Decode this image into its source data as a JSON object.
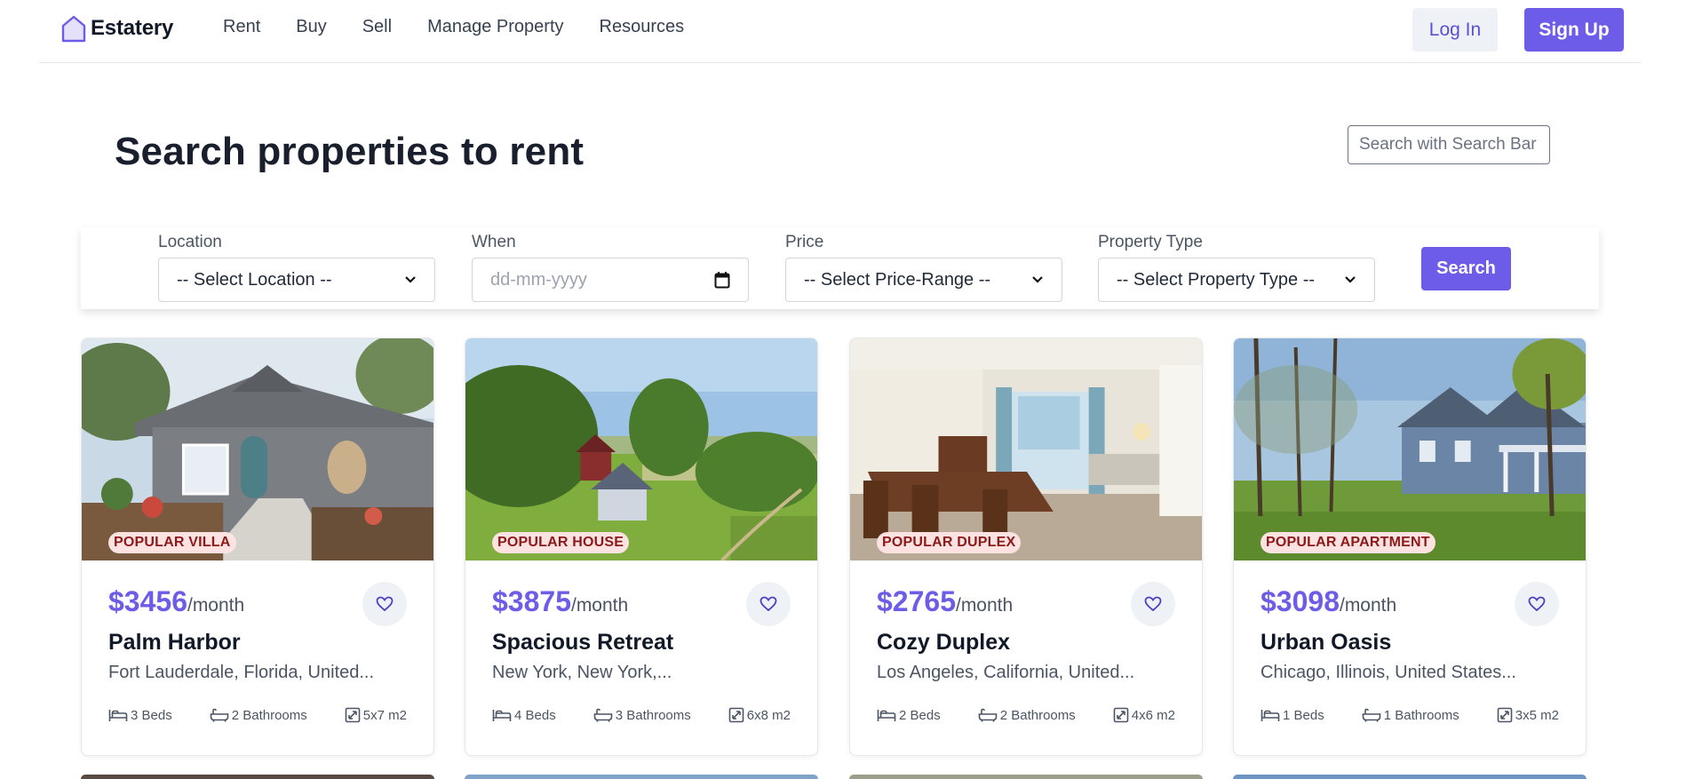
{
  "brand": {
    "name": "Estatery",
    "accent": "#6c5ce7"
  },
  "nav": {
    "links": [
      "Rent",
      "Buy",
      "Sell",
      "Manage Property",
      "Resources"
    ],
    "login_label": "Log In",
    "signup_label": "Sign Up"
  },
  "header": {
    "title": "Search properties to rent",
    "search_placeholder": "Search with Search Bar"
  },
  "filters": {
    "location": {
      "label": "Location",
      "value": "-- Select Location --"
    },
    "when": {
      "label": "When",
      "value": "dd-mm-yyyy"
    },
    "price": {
      "label": "Price",
      "value": "-- Select Price-Range --"
    },
    "type": {
      "label": "Property Type",
      "value": "-- Select Property Type --"
    },
    "search_label": "Search"
  },
  "listings": [
    {
      "badge": "POPULAR VILLA",
      "price": "$3456",
      "unit": "/month",
      "name": "Palm Harbor",
      "location": "Fort Lauderdale, Florida, United...",
      "beds": "3 Beds",
      "baths": "2 Bathrooms",
      "area": "5x7 m2"
    },
    {
      "badge": "POPULAR HOUSE",
      "price": "$3875",
      "unit": "/month",
      "name": "Spacious Retreat",
      "location": "New York, New York,...",
      "beds": "4 Beds",
      "baths": "3 Bathrooms",
      "area": "6x8 m2"
    },
    {
      "badge": "POPULAR DUPLEX",
      "price": "$2765",
      "unit": "/month",
      "name": "Cozy Duplex",
      "location": "Los Angeles, California, United...",
      "beds": "2 Beds",
      "baths": "2 Bathrooms",
      "area": "4x6 m2"
    },
    {
      "badge": "POPULAR APARTMENT",
      "price": "$3098",
      "unit": "/month",
      "name": "Urban Oasis",
      "location": "Chicago, Illinois, United States...",
      "beds": "1 Beds",
      "baths": "1 Bathrooms",
      "area": "3x5 m2"
    }
  ],
  "icons": {
    "logo": "house-outline-icon",
    "favorite": "heart-icon",
    "beds": "bed-icon",
    "baths": "bathtub-icon",
    "area": "area-icon",
    "dropdown": "chevron-down-icon",
    "date": "calendar-icon"
  }
}
